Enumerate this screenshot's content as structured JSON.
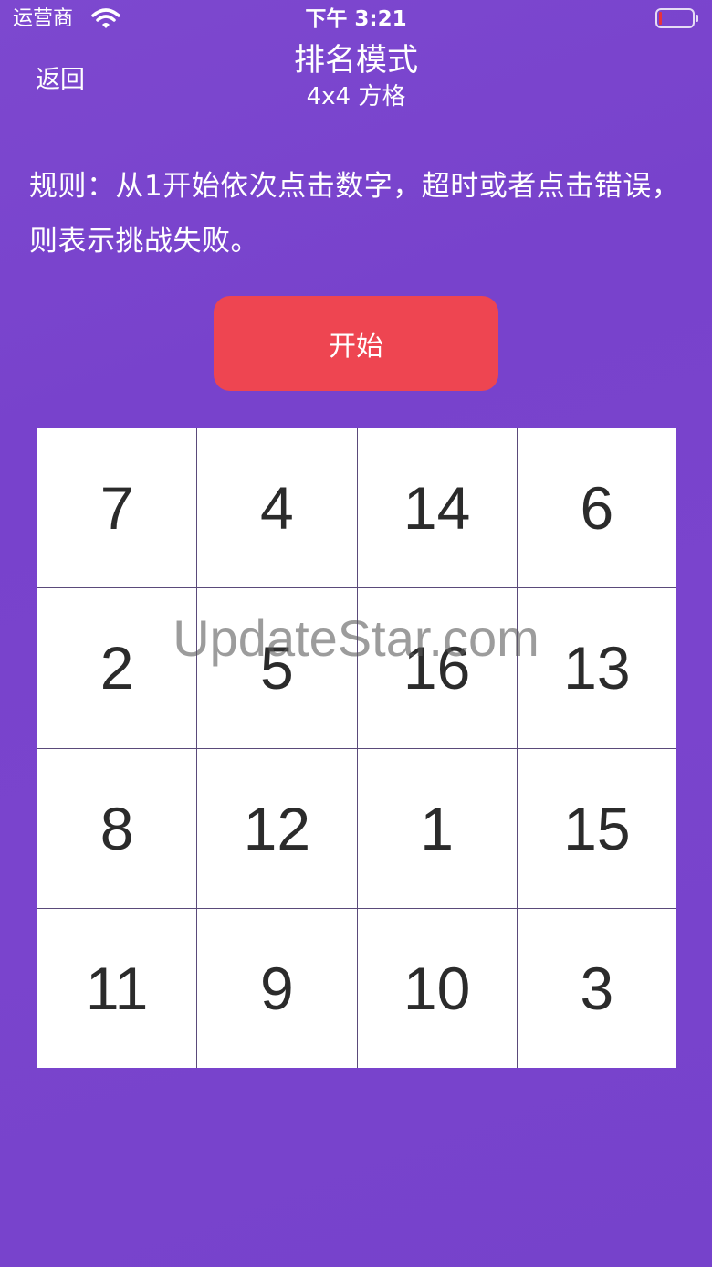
{
  "status_bar": {
    "carrier": "运营商",
    "time": "下午 3:21",
    "wifi_icon": "wifi-icon",
    "battery_icon": "battery-low-icon",
    "battery_color": "#e8323c"
  },
  "nav": {
    "back_label": "返回",
    "title": "排名模式",
    "subtitle": "4x4 方格"
  },
  "rules": "规则：从1开始依次点击数字，超时或者点击错误，则表示挑战失败。",
  "start_button": {
    "label": "开始",
    "color": "#ee4551"
  },
  "grid": {
    "rows": 4,
    "cols": 4,
    "cells": [
      "7",
      "4",
      "14",
      "6",
      "2",
      "5",
      "16",
      "13",
      "8",
      "12",
      "1",
      "15",
      "11",
      "9",
      "10",
      "3"
    ]
  },
  "watermark": "UpdateStar.com",
  "colors": {
    "background": "#7a44cd",
    "cell_background": "#ffffff",
    "cell_text": "#2b2b2b"
  }
}
